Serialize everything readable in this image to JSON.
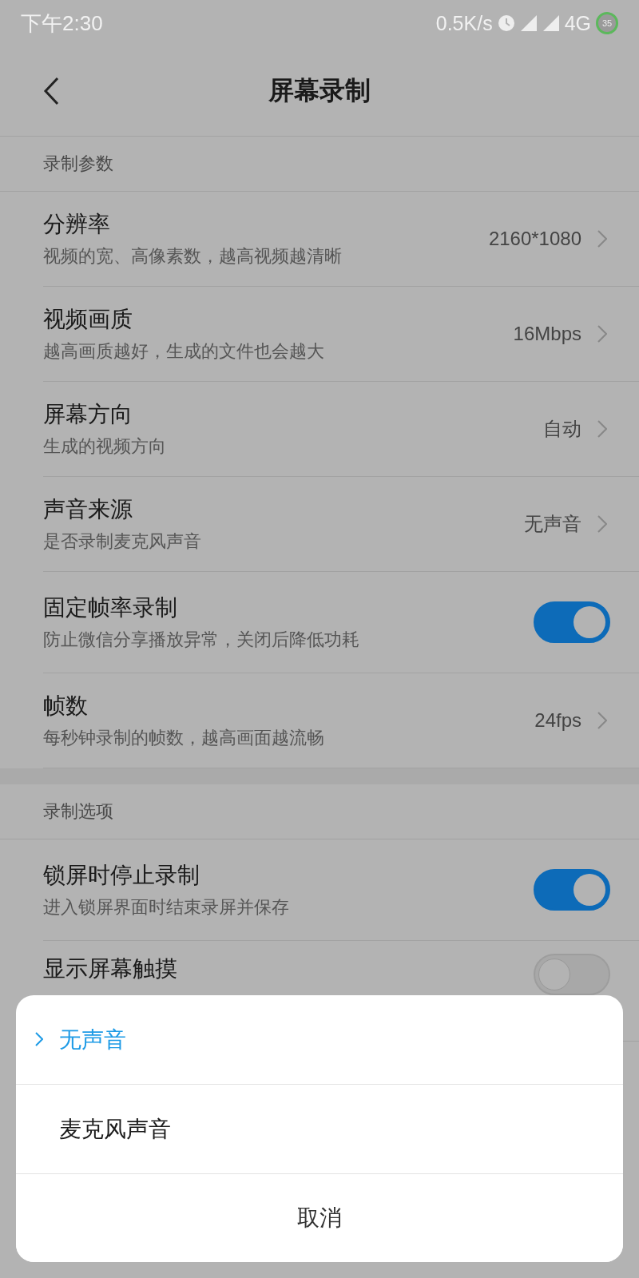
{
  "status_bar": {
    "time": "下午2:30",
    "net_speed": "0.5K/s",
    "network": "4G",
    "battery": "35"
  },
  "header": {
    "title": "屏幕录制"
  },
  "sections": [
    {
      "label": "录制参数",
      "items": [
        {
          "kind": "value",
          "title": "分辨率",
          "subtitle": "视频的宽、高像素数，越高视频越清晰",
          "value": "2160*1080"
        },
        {
          "kind": "value",
          "title": "视频画质",
          "subtitle": "越高画质越好，生成的文件也会越大",
          "value": "16Mbps"
        },
        {
          "kind": "value",
          "title": "屏幕方向",
          "subtitle": "生成的视频方向",
          "value": "自动"
        },
        {
          "kind": "value",
          "title": "声音来源",
          "subtitle": "是否录制麦克风声音",
          "value": "无声音"
        },
        {
          "kind": "toggle",
          "title": "固定帧率录制",
          "subtitle": "防止微信分享播放异常，关闭后降低功耗",
          "on": true
        },
        {
          "kind": "value",
          "title": "帧数",
          "subtitle": "每秒钟录制的帧数，越高画面越流畅",
          "value": "24fps"
        }
      ]
    },
    {
      "label": "录制选项",
      "items": [
        {
          "kind": "toggle",
          "title": "锁屏时停止录制",
          "subtitle": "进入锁屏界面时结束录屏并保存",
          "on": true
        },
        {
          "kind": "toggle",
          "title": "显示屏幕触摸",
          "on": false
        }
      ]
    }
  ],
  "sheet": {
    "options": [
      {
        "label": "无声音",
        "selected": true
      },
      {
        "label": "麦克风声音",
        "selected": false
      }
    ],
    "cancel": "取消"
  }
}
